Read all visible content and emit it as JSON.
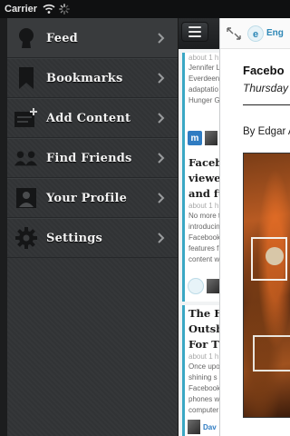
{
  "status_bar": {
    "carrier": "Carrier"
  },
  "menu": {
    "items": [
      {
        "label": "Feed",
        "icon": "user-silhouette-icon",
        "active": true
      },
      {
        "label": "Bookmarks",
        "icon": "bookmark-icon",
        "active": false
      },
      {
        "label": "Add Content",
        "icon": "add-content-icon",
        "active": false
      },
      {
        "label": "Find Friends",
        "icon": "friends-icon",
        "active": false
      },
      {
        "label": "Your Profile",
        "icon": "profile-icon",
        "active": false
      },
      {
        "label": "Settings",
        "icon": "gear-icon",
        "active": false
      }
    ]
  },
  "feed": {
    "cards": [
      {
        "meta": "about 1 h",
        "body": [
          "Jennifer L",
          "Everdeen",
          "adaptatio",
          "Hunger Ga"
        ],
        "footer": "m-badge"
      },
      {
        "title": [
          "Faceboo",
          "viewer",
          "and ful"
        ],
        "meta": "about 1 h",
        "body": [
          "No more t",
          "introducin",
          "Facebook",
          "features f",
          "content w"
        ],
        "footer": "e-badge"
      },
      {
        "title": [
          "The Fa",
          "Outshi",
          "For Th"
        ],
        "meta": "about 1 h",
        "body": [
          "Once upo",
          "shining s",
          "Facebook",
          "phones w",
          "computer"
        ],
        "footer": "author",
        "author": "Dav"
      }
    ]
  },
  "article": {
    "source_name": "Eng",
    "title": "Facebo",
    "date": "Thursday",
    "byline": "By Edgar A"
  },
  "colors": {
    "accent": "#3aa7c4",
    "source_blue": "#2c87b6"
  }
}
